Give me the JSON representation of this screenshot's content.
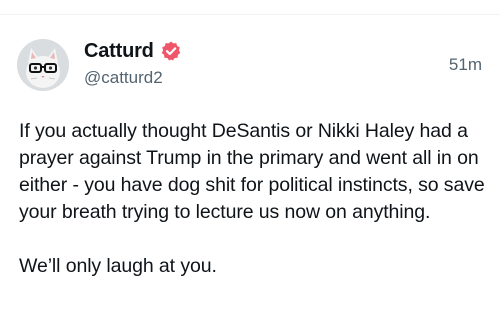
{
  "post": {
    "author": {
      "display_name": "Catturd",
      "handle": "@catturd2",
      "verified": true,
      "avatar_icon": "cat-with-glasses-avatar",
      "badge_icon": "verified-check-icon",
      "badge_color": "#f0566a"
    },
    "timestamp": "51m",
    "body": {
      "paragraph_1": "If you actually thought DeSantis or Nikki Haley had a prayer against Trump in the primary and went all in on either - you have dog shit for political instincts, so save your breath trying to lecture us now on anything.",
      "paragraph_2": "We’ll only laugh at you."
    }
  },
  "colors": {
    "text_primary": "#0f1419",
    "text_secondary": "#536471",
    "divider": "#eff3f4"
  }
}
